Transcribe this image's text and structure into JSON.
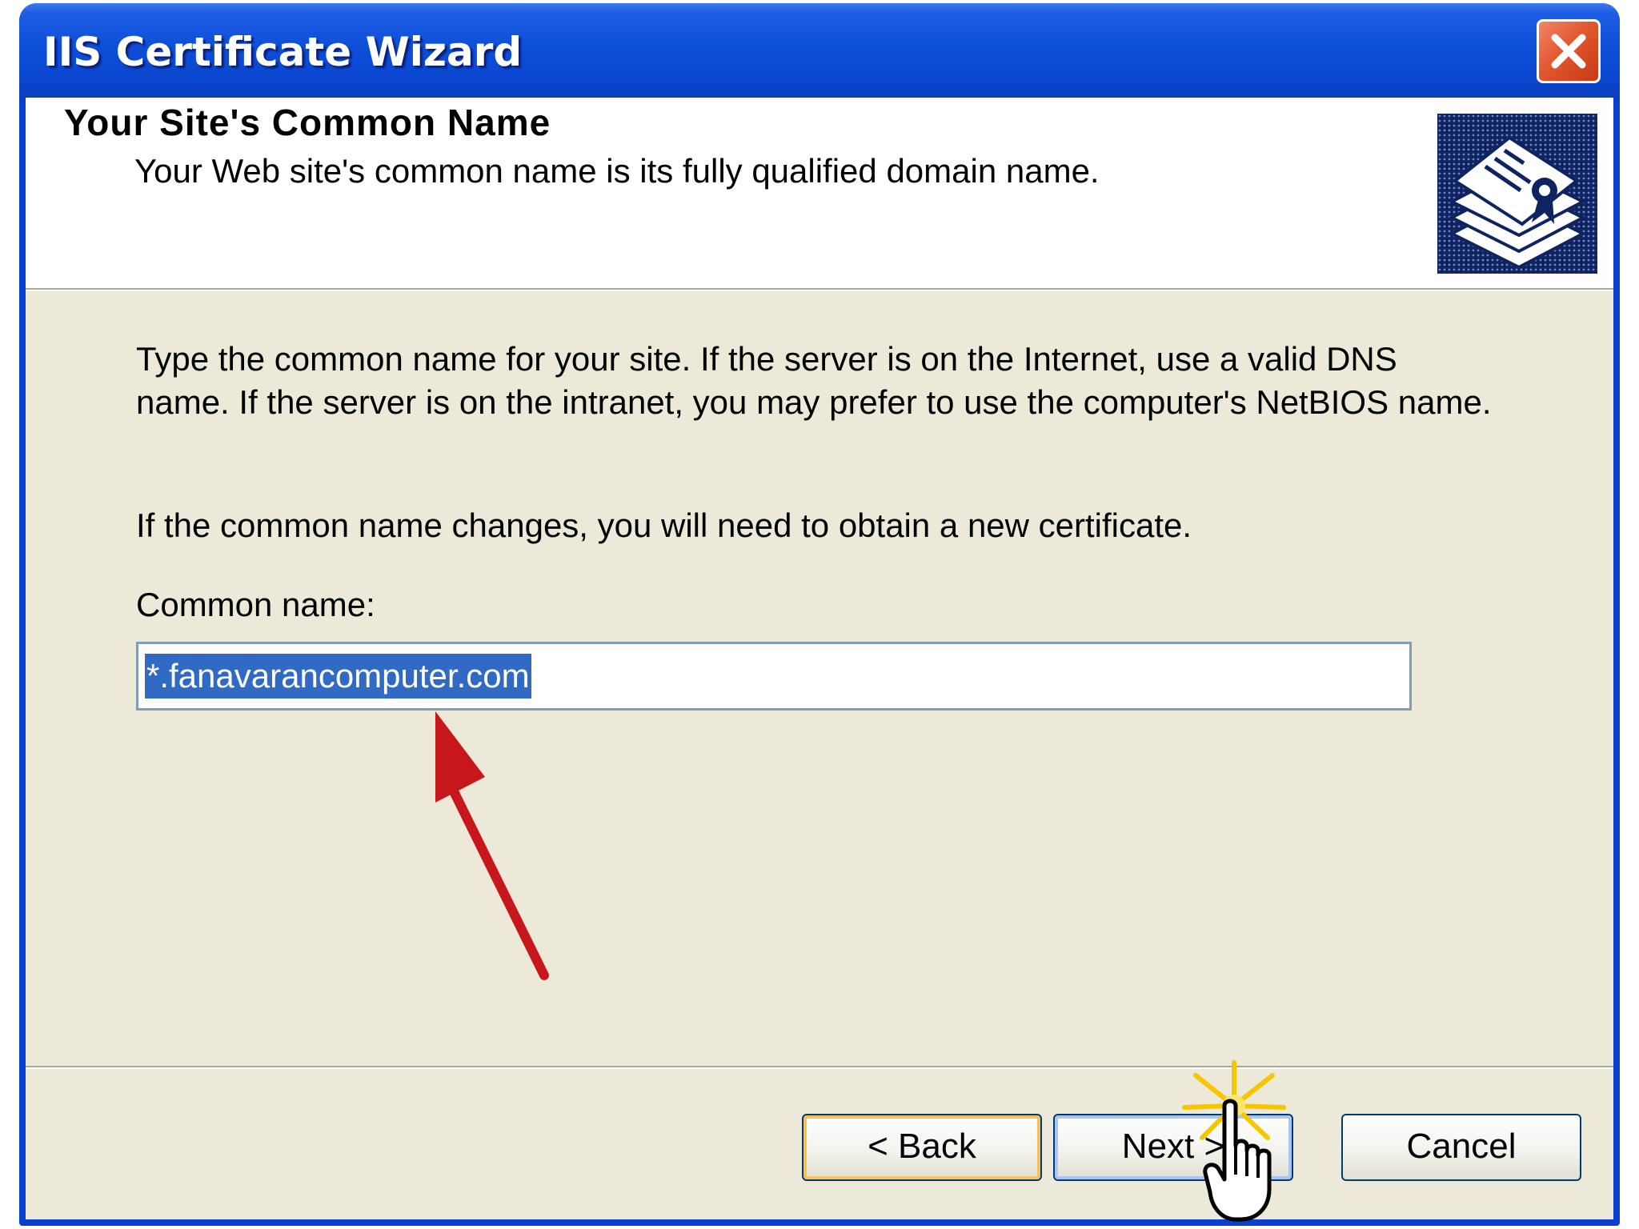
{
  "window": {
    "title": "IIS Certificate Wizard",
    "close_icon": "close-icon"
  },
  "header": {
    "title": "Your Site's Common Name",
    "subtitle": "Your Web site's common name is its fully qualified domain name.",
    "icon": "certificate-stack-icon"
  },
  "body": {
    "description": "Type the common name for your site. If the server is on the Internet, use a valid DNS name. If the server is on the intranet, you may prefer to use the computer's NetBIOS name.",
    "note": "If the common name changes, you will need to obtain a new certificate.",
    "common_name_label": "Common name:",
    "common_name_value": "*.fanavarancomputer.com"
  },
  "annotation": {
    "arrow_color": "#C8161D",
    "arrow_icon": "red-arrow-icon"
  },
  "buttons": {
    "back": "< Back",
    "next": "Next >",
    "cancel": "Cancel"
  },
  "colors": {
    "titlebar": "#0A47D0",
    "dialog_bg": "#ECE9D8",
    "selection": "#316AC5",
    "close_button": "#E2582F"
  }
}
